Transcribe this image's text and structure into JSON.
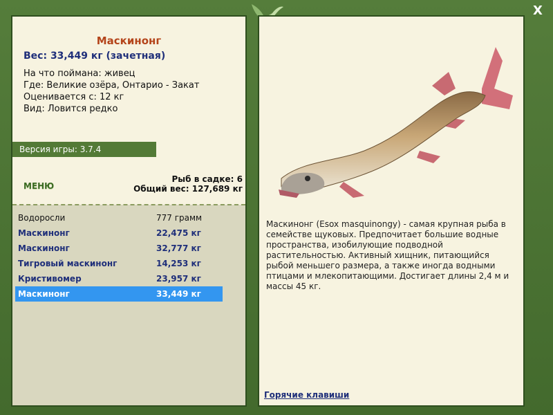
{
  "window": {
    "close_label": "X"
  },
  "fish": {
    "title": "Маскинонг",
    "weight_line": "Вес: 33,449 кг (зачетная)",
    "info_lines": [
      "На что поймана: живец",
      "Где: Великие озёра, Онтарио - Закат",
      "Оценивается с: 12 кг",
      "Вид: Ловится редко"
    ],
    "description": "Маскинонг (Esox masquinongy) - самая крупная рыба в семействе щуковых. Предпочитает большие водные пространства, изобилующие подводной растительностью. Активный хищник, питающийся рыбой меньшего размера, а также иногда водными птицами и млекопитающими. Достигает длины 2,4 м и массы 45 кг."
  },
  "version": "Версия игры: 3.7.4",
  "menu_label": "МЕНЮ",
  "keepnet": {
    "count_line": "Рыб в садке: 6",
    "total_line": "Общий вес: 127,689 кг"
  },
  "catch_list": [
    {
      "name": "Водоросли",
      "weight": "777 грамм"
    },
    {
      "name": "Маскинонг",
      "weight": "22,475 кг"
    },
    {
      "name": "Маскинонг",
      "weight": "32,777 кг"
    },
    {
      "name": "Тигровый маскинонг",
      "weight": "14,253 кг"
    },
    {
      "name": "Кристивомер",
      "weight": "23,957 кг"
    },
    {
      "name": "Маскинонг",
      "weight": "33,449 кг"
    }
  ],
  "hotkeys_label": "Горячие клавиши",
  "colors": {
    "frame": "#4a7233",
    "panel": "#f7f3e0",
    "title": "#b4441a",
    "navy": "#1f2f7a",
    "selected": "#3396f0"
  }
}
